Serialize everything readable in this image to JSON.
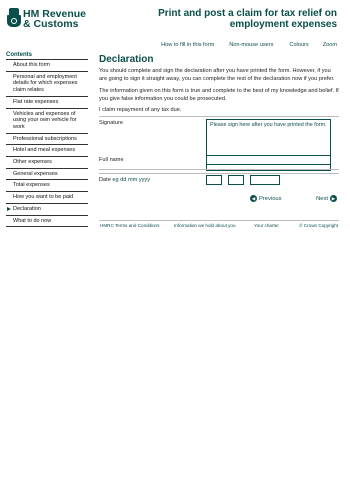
{
  "brand": {
    "name_line1": "HM Revenue",
    "name_line2": "& Customs"
  },
  "header": {
    "title_line1": "Print and post a claim for tax relief on",
    "title_line2": "employment expenses"
  },
  "topnav": {
    "items": [
      "How to fill in this form",
      "Non-mouse users",
      "Colours",
      "Zoom"
    ]
  },
  "sidebar": {
    "heading": "Contents",
    "items": [
      {
        "label": "About this form"
      },
      {
        "label": "Personal and employment details for which expenses claim relates"
      },
      {
        "label": "Flat rate expenses"
      },
      {
        "label": "Vehicles and expenses of using your own vehicle for work"
      },
      {
        "label": "Professional subscriptions"
      },
      {
        "label": "Hotel and meal expenses"
      },
      {
        "label": "Other expenses"
      },
      {
        "label": "General expenses"
      },
      {
        "label": "Total expenses"
      },
      {
        "label": "How you want to be paid"
      },
      {
        "label": "Declaration"
      },
      {
        "label": "What to do now"
      }
    ]
  },
  "main": {
    "title": "Declaration",
    "para1": "You should complete and sign the declaration after you have printed the form. However, if you are going to sign it straight away, you can complete the rest of the declaration now if you prefer.",
    "para2": "The information given on this form is true and complete to the best of my knowledge and belief. If you give false information you could be prosecuted.",
    "para3": "I claim repayment of any tax due.",
    "signature_label": "Signature",
    "signature_box": "Please sign here after you have printed the form.",
    "fullname_label": "Full name",
    "date_label": "Date",
    "date_hint": "eg dd mm yyyy"
  },
  "pager": {
    "previous": "Previous",
    "next": "Next"
  },
  "footer": {
    "links": [
      "HMRC Terms and Conditions",
      "Information we hold about you",
      "Your charter",
      "© Crown Copyright"
    ]
  },
  "colors": {
    "brand": "#0b4f4a",
    "rule": "#bdbdbd"
  }
}
